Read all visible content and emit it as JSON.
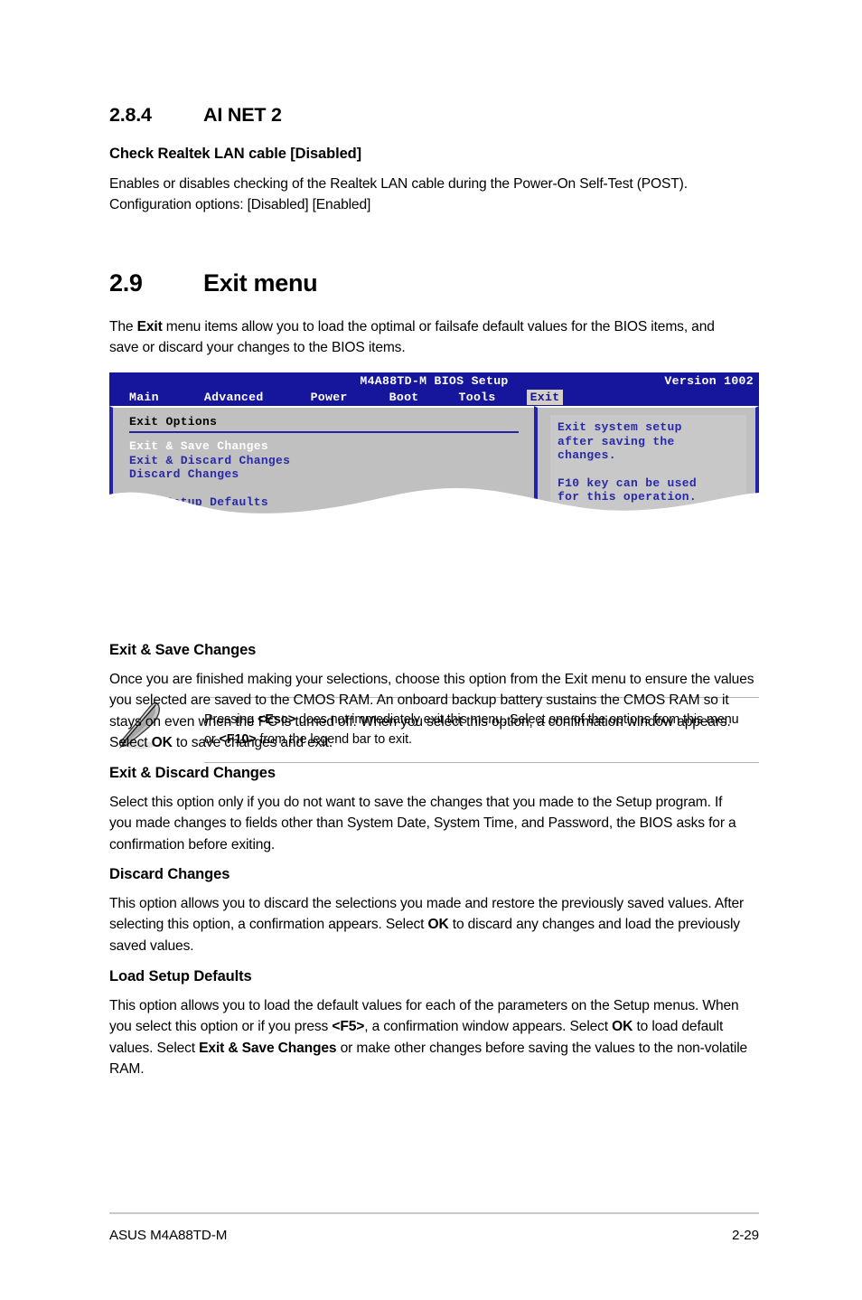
{
  "section_284": {
    "number": "2.8.4",
    "title": "AI NET 2",
    "sub_head": "Check Realtek LAN cable [Disabled]",
    "body": "Enables or disables checking of the Realtek LAN cable during the Power-On Self-Test (POST). Configuration options: [Disabled] [Enabled]"
  },
  "section_29": {
    "number": "2.9",
    "title": "Exit menu",
    "intro_a": "The ",
    "intro_b": "Exit",
    "intro_c": " menu items allow you to load the optimal or failsafe default values for the BIOS items, and save or discard your changes to the BIOS items."
  },
  "bios": {
    "title": "M4A88TD-M BIOS Setup",
    "version": "Version 1002",
    "tabs": [
      {
        "label": "Main",
        "selected": false
      },
      {
        "label": "Advanced",
        "selected": false
      },
      {
        "label": "Power",
        "selected": false
      },
      {
        "label": "Boot",
        "selected": false
      },
      {
        "label": "Tools",
        "selected": false
      },
      {
        "label": "Exit",
        "selected": true
      }
    ],
    "panel_title": "Exit Options",
    "options": [
      {
        "label": "Exit & Save Changes",
        "highlighted": true
      },
      {
        "label": "Exit & Discard Changes",
        "highlighted": false
      },
      {
        "label": "Discard Changes",
        "highlighted": false
      },
      {
        "label": "Load Setup Defaults",
        "highlighted": false
      }
    ],
    "help": {
      "line1": "Exit system setup",
      "line2": "after saving the",
      "line3": "changes.",
      "line4": "F10 key can be used",
      "line5": "for this operation."
    },
    "colors": {
      "header_bg": "#16169c",
      "panel_bg": "#c0c0c0",
      "border": "#2222aa",
      "item_text": "#2929a8",
      "highlight_text": "#ffffff",
      "tab_selected_bg": "#d4d0c8"
    }
  },
  "note": {
    "icon": "pencil-icon",
    "line1_a": "Pressing ",
    "line1_b": "<Esc>",
    "line1_c": " does not immediately exit this menu. Select one of the options from this menu or ",
    "line1_d": "<F10>",
    "line1_e": " from the legend bar to exit."
  },
  "topics": [
    {
      "heading": "Exit & Save Changes",
      "body_a": "Once you are finished making your selections, choose this option from the Exit menu to ensure the values you selected are saved to the CMOS RAM. An onboard backup battery sustains the CMOS RAM so it stays on even when the PC is turned off. When you select this option, a confirmation window appears. Select ",
      "body_b": "OK",
      "body_c": " to save changes and exit."
    },
    {
      "heading": "Exit & Discard Changes",
      "body_a": "Select this option only if you do not want to save the changes that you made to the Setup program. If you made changes to fields other than System Date, System Time, and Password, the BIOS asks for a confirmation before exiting.",
      "body_b": "",
      "body_c": ""
    },
    {
      "heading": "Discard Changes",
      "body_a": "This option allows you to discard the selections you made and restore the previously saved values. After selecting this option, a confirmation appears. Select ",
      "body_b": "OK",
      "body_c": " to discard any changes and load the previously saved values."
    },
    {
      "heading": "Load Setup Defaults",
      "body_a": "This option allows you to load the default values for each of the parameters on the Setup menus. When you select this option or if you press ",
      "body_b": "<F5>",
      "body_c": ", a confirmation window appears. Select ",
      "body_d": "OK",
      "body_e": " to load default values. Select ",
      "body_f": "Exit & Save Changes",
      "body_g": " or make other changes before saving the values to the non-volatile RAM."
    }
  ],
  "footer": {
    "left": "ASUS M4A88TD-M",
    "right": "2-29"
  }
}
